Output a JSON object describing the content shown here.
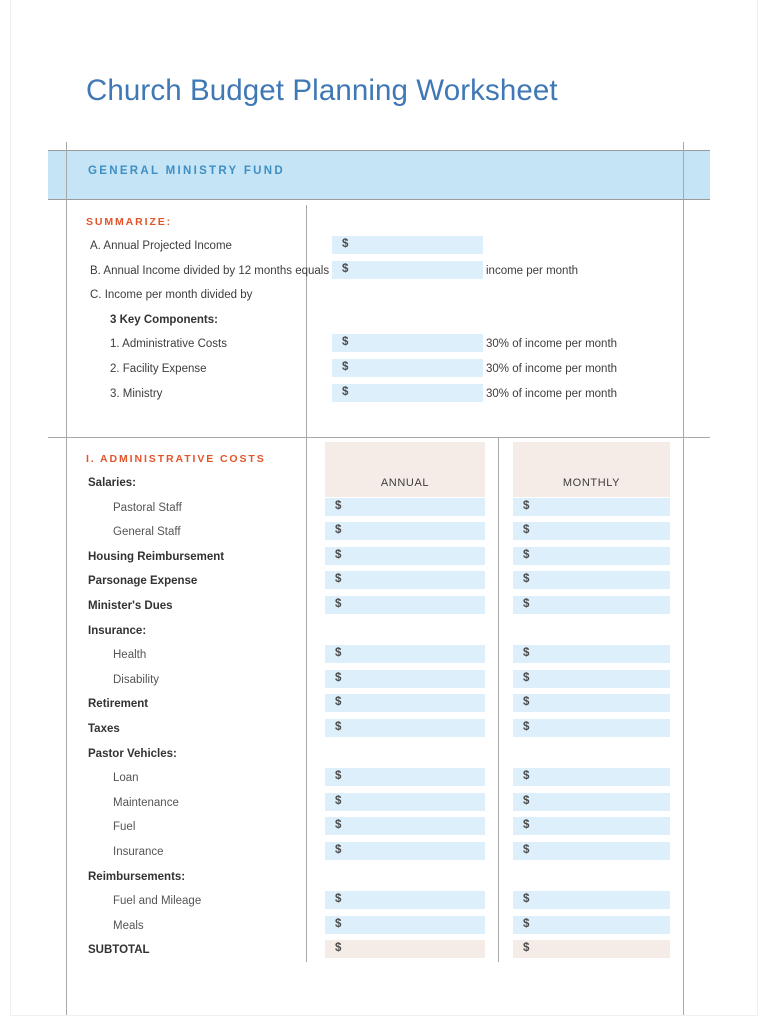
{
  "document": {
    "title": "Church Budget Planning Worksheet",
    "fund_band_label": "GENERAL MINISTRY FUND"
  },
  "colors": {
    "title_blue": "#3f78b5",
    "band_blue": "#c5e4f5",
    "band_text_blue": "#3e8fc4",
    "section_orange": "#e2552a",
    "input_blue": "#ddeffb",
    "subtotal_beige": "#f5ece7",
    "rule_gray": "#a8a8a8"
  },
  "summarize": {
    "heading": "SUMMARIZE:",
    "dollar_sign": "$",
    "rows": [
      {
        "label": "A. Annual Projected Income",
        "has_input": true,
        "descriptor": ""
      },
      {
        "label": "B. Annual Income divided by 12 months equals",
        "has_input": true,
        "descriptor": "income per month"
      },
      {
        "label": "C. Income per month divided by",
        "has_input": false,
        "descriptor": ""
      },
      {
        "label": "3 Key Components:",
        "has_input": false,
        "descriptor": "",
        "bold": true,
        "indent": true
      },
      {
        "label": "1. Administrative Costs",
        "has_input": true,
        "descriptor": "30% of income per month",
        "indent": true
      },
      {
        "label": "2. Facility Expense",
        "has_input": true,
        "descriptor": "30% of income per month",
        "indent": true
      },
      {
        "label": "3. Ministry",
        "has_input": true,
        "descriptor": "30% of income per month",
        "indent": true
      }
    ]
  },
  "administrative": {
    "heading": "I. ADMINISTRATIVE COSTS",
    "dollar_sign": "$",
    "column_headers": {
      "annual": "ANNUAL",
      "monthly": "MONTHLY"
    },
    "rows": [
      {
        "label": "Salaries:",
        "style": "bold",
        "has_input": false
      },
      {
        "label": "Pastoral Staff",
        "style": "sub",
        "has_input": true
      },
      {
        "label": "General Staff",
        "style": "sub",
        "has_input": true
      },
      {
        "label": "Housing Reimbursement",
        "style": "bold",
        "has_input": true
      },
      {
        "label": "Parsonage Expense",
        "style": "bold",
        "has_input": true
      },
      {
        "label": "Minister's Dues",
        "style": "bold",
        "has_input": true
      },
      {
        "label": "Insurance:",
        "style": "bold",
        "has_input": false
      },
      {
        "label": "Health",
        "style": "sub",
        "has_input": true
      },
      {
        "label": "Disability",
        "style": "sub",
        "has_input": true
      },
      {
        "label": "Retirement",
        "style": "bold",
        "has_input": true
      },
      {
        "label": "Taxes",
        "style": "bold",
        "has_input": true
      },
      {
        "label": "Pastor Vehicles:",
        "style": "bold",
        "has_input": false
      },
      {
        "label": "Loan",
        "style": "sub",
        "has_input": true
      },
      {
        "label": "Maintenance",
        "style": "sub",
        "has_input": true
      },
      {
        "label": "Fuel",
        "style": "sub",
        "has_input": true
      },
      {
        "label": "Insurance",
        "style": "sub",
        "has_input": true
      },
      {
        "label": "Reimbursements:",
        "style": "bold",
        "has_input": false
      },
      {
        "label": "Fuel and Mileage",
        "style": "sub",
        "has_input": true
      },
      {
        "label": "Meals",
        "style": "sub",
        "has_input": true
      },
      {
        "label": "SUBTOTAL",
        "style": "bold",
        "has_input": true,
        "subtotal": true
      }
    ]
  }
}
